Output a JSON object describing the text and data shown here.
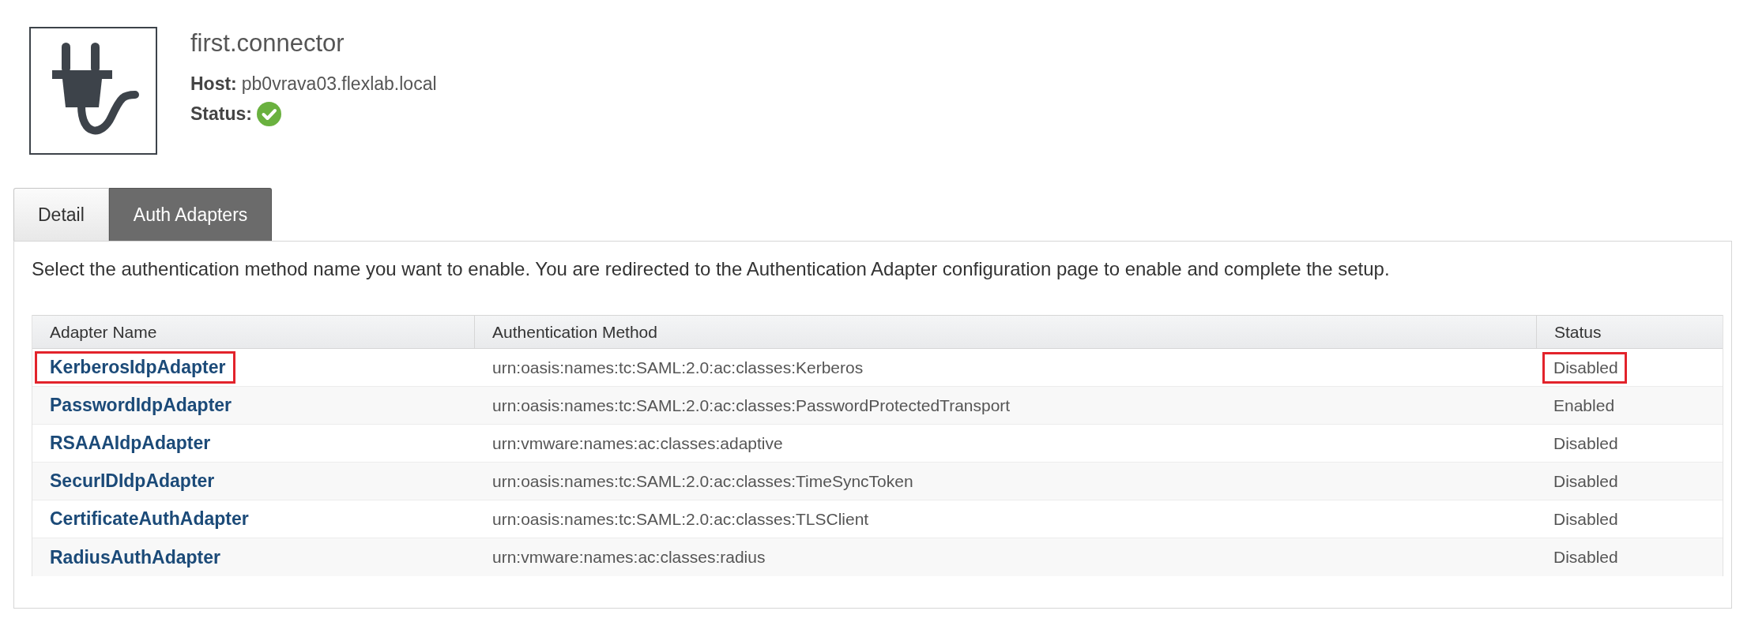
{
  "connector": {
    "name": "first.connector",
    "host": {
      "label": "Host:",
      "value": "pb0vrava03.flexlab.local"
    },
    "status": {
      "label": "Status:",
      "ok": true
    }
  },
  "tabs": [
    {
      "label": "Detail",
      "selected": false
    },
    {
      "label": "Auth Adapters",
      "selected": true
    }
  ],
  "panel": {
    "description": "Select the authentication method name you want to enable. You are redirected to the Authentication Adapter configuration page to enable and complete the setup.",
    "table": {
      "columns": [
        "Adapter Name",
        "Authentication Method",
        "Status"
      ],
      "rows": [
        {
          "adapter_name": "KerberosIdpAdapter",
          "method": "urn:oasis:names:tc:SAML:2.0:ac:classes:Kerberos",
          "status": "Disabled",
          "highlighted": true
        },
        {
          "adapter_name": "PasswordIdpAdapter",
          "method": "urn:oasis:names:tc:SAML:2.0:ac:classes:PasswordProtectedTransport",
          "status": "Enabled",
          "highlighted": false
        },
        {
          "adapter_name": "RSAAAIdpAdapter",
          "method": "urn:vmware:names:ac:classes:adaptive",
          "status": "Disabled",
          "highlighted": false
        },
        {
          "adapter_name": "SecurIDIdpAdapter",
          "method": "urn:oasis:names:tc:SAML:2.0:ac:classes:TimeSyncToken",
          "status": "Disabled",
          "highlighted": false
        },
        {
          "adapter_name": "CertificateAuthAdapter",
          "method": "urn:oasis:names:tc:SAML:2.0:ac:classes:TLSClient",
          "status": "Disabled",
          "highlighted": false
        },
        {
          "adapter_name": "RadiusAuthAdapter",
          "method": "urn:vmware:names:ac:classes:radius",
          "status": "Disabled",
          "highlighted": false
        }
      ]
    }
  }
}
